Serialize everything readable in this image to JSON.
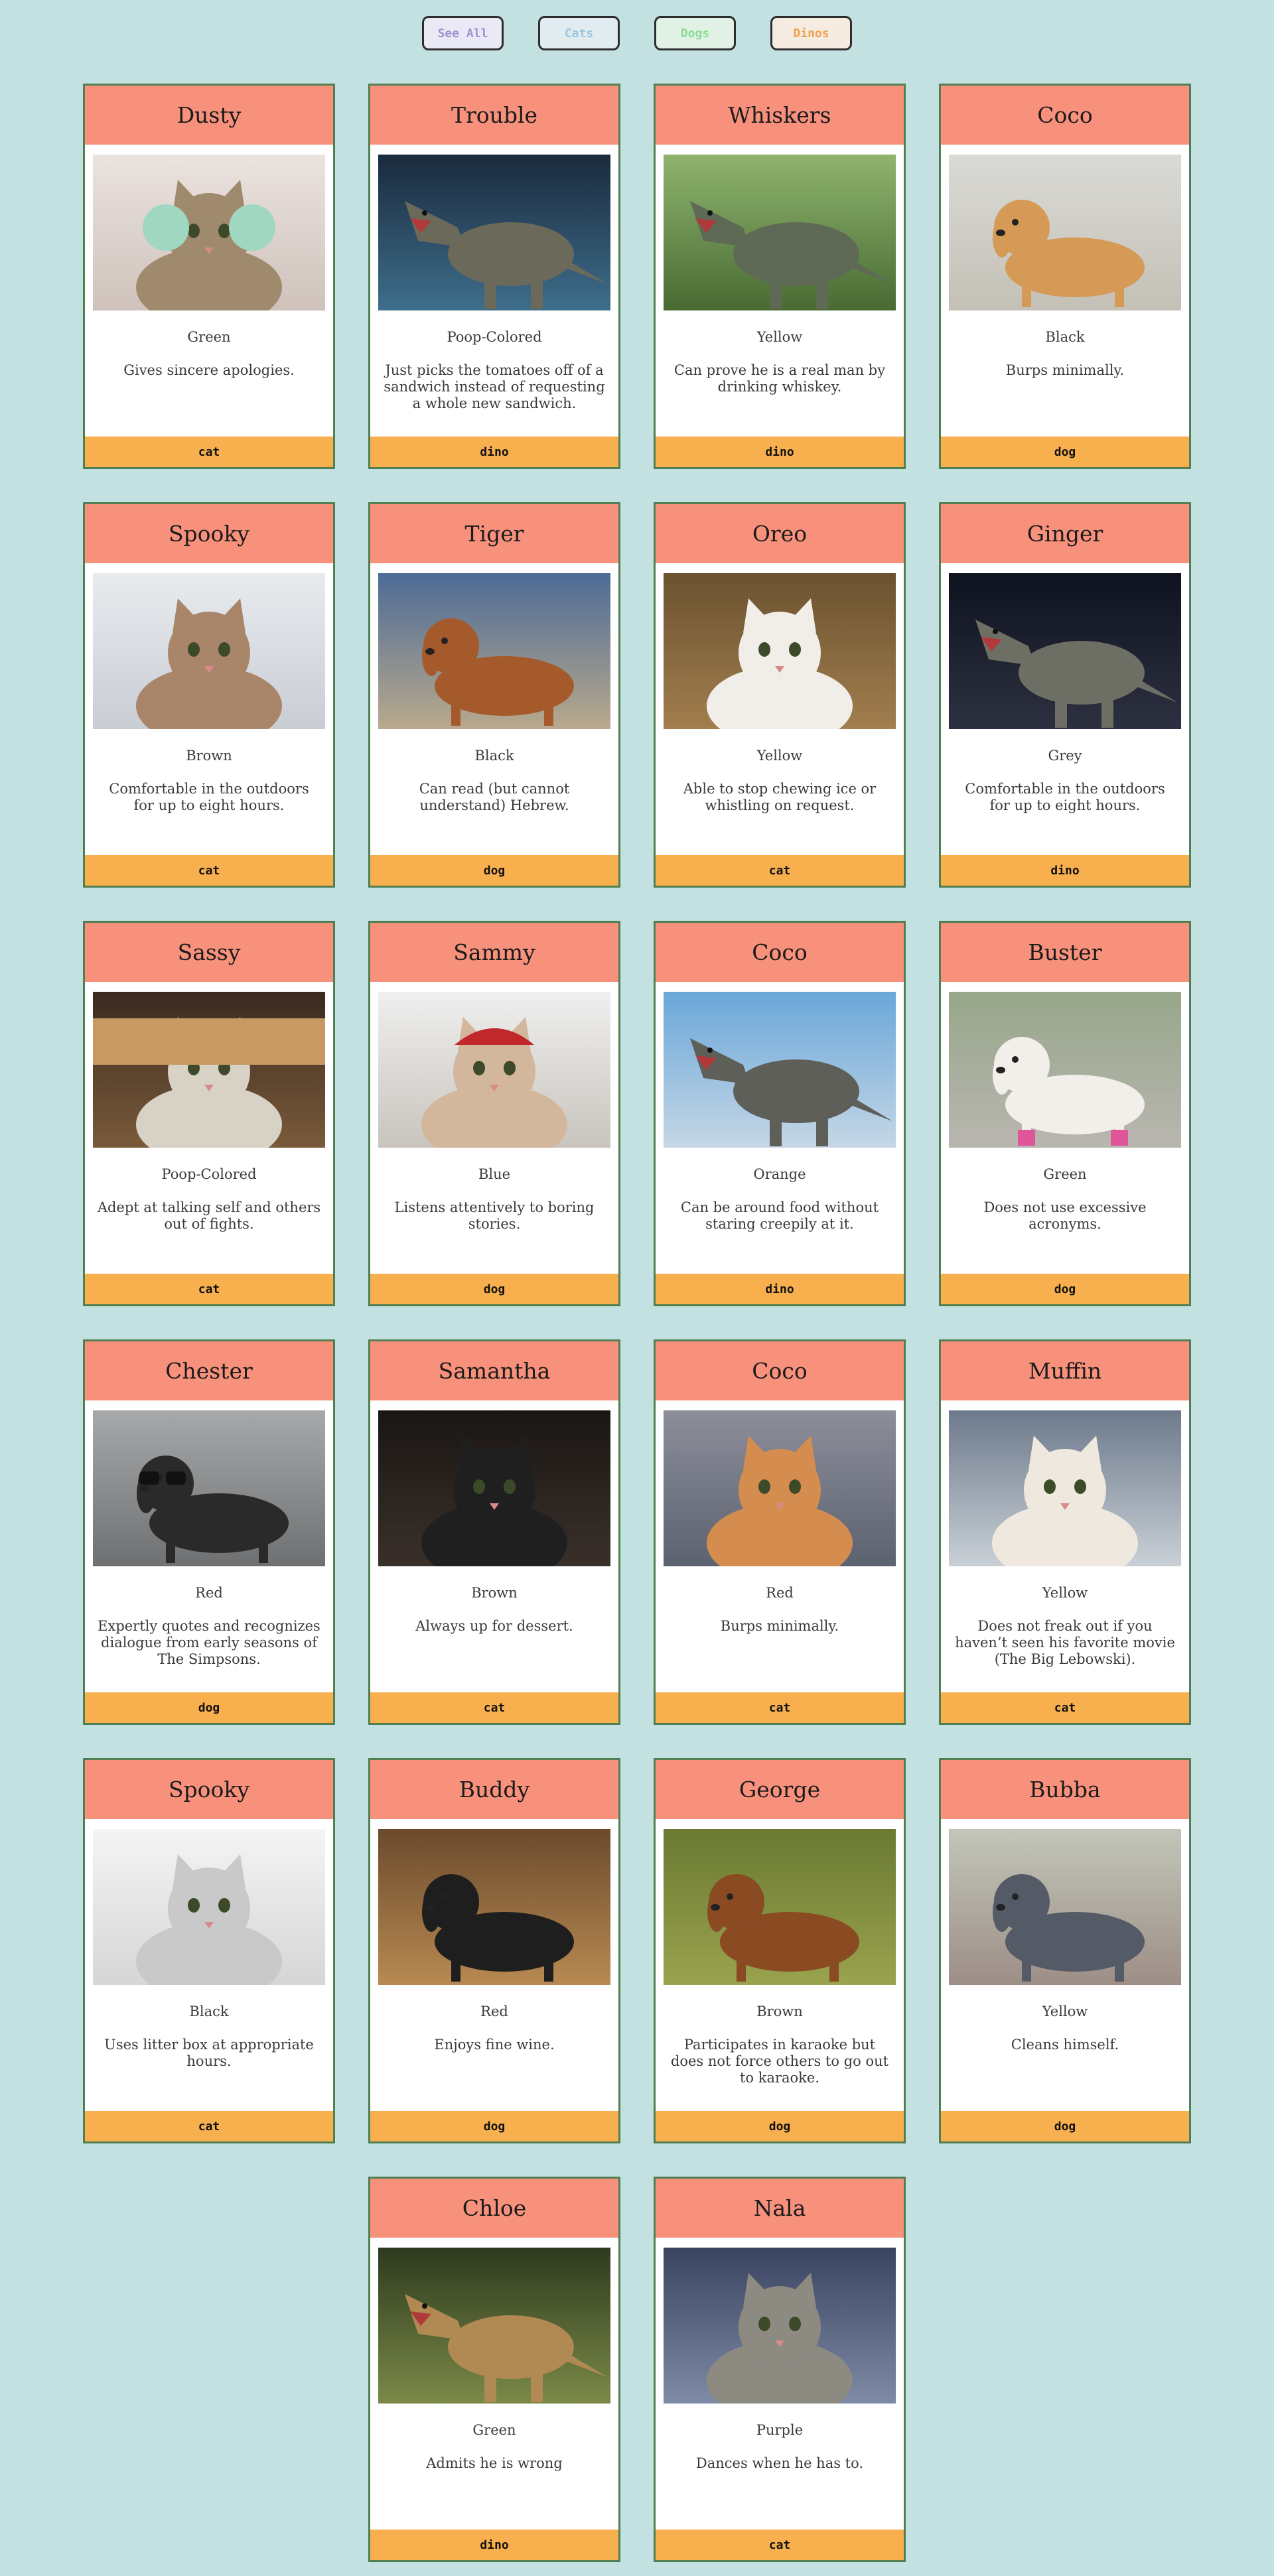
{
  "filters": [
    {
      "label": "See All",
      "cls": "all"
    },
    {
      "label": "Cats",
      "cls": "cats"
    },
    {
      "label": "Dogs",
      "cls": "dogs"
    },
    {
      "label": "Dinos",
      "cls": "dinos"
    }
  ],
  "pets": [
    {
      "name": "Dusty",
      "color": "Green",
      "desc": "Gives sincere apologies.",
      "type": "cat",
      "photo": "cat-with-yarn-earmuffs"
    },
    {
      "name": "Trouble",
      "color": "Poop-Colored",
      "desc": "Just picks the tomatoes off of a sandwich instead of requesting a whole new sandwich.",
      "type": "dino",
      "photo": "dinosaur-spinosaurus"
    },
    {
      "name": "Whiskers",
      "color": "Yellow",
      "desc": "Can prove he is a real man by drinking whiskey.",
      "type": "dino",
      "photo": "dinosaur-trex-forest"
    },
    {
      "name": "Coco",
      "color": "Black",
      "desc": "Burps minimally.",
      "type": "dog",
      "photo": "corgi-with-stick"
    },
    {
      "name": "Spooky",
      "color": "Brown",
      "desc": "Comfortable in the outdoors for up to eight hours.",
      "type": "cat",
      "photo": "maine-coon-cat"
    },
    {
      "name": "Tiger",
      "color": "Black",
      "desc": "Can read (but cannot understand) Hebrew.",
      "type": "dog",
      "photo": "basset-hound-running"
    },
    {
      "name": "Oreo",
      "color": "Yellow",
      "desc": "Able to stop chewing ice or whistling on request.",
      "type": "cat",
      "photo": "sleeping-cat"
    },
    {
      "name": "Ginger",
      "color": "Grey",
      "desc": "Comfortable in the outdoors for up to eight hours.",
      "type": "dino",
      "photo": "dinosaur-with-hat"
    },
    {
      "name": "Sassy",
      "color": "Poop-Colored",
      "desc": "Adept at talking self and others out of fights.",
      "type": "cat",
      "photo": "cat-in-paper-bag"
    },
    {
      "name": "Sammy",
      "color": "Blue",
      "desc": "Listens attentively to boring stories.",
      "type": "dog",
      "photo": "grumpy-cat-devil-hat"
    },
    {
      "name": "Coco",
      "color": "Orange",
      "desc": "Can be around food without staring creepily at it.",
      "type": "dino",
      "photo": "dinosaur-spinosaurus-outdoor"
    },
    {
      "name": "Buster",
      "color": "Green",
      "desc": "Does not use excessive acronyms.",
      "type": "dog",
      "photo": "jack-russell-pink-boots"
    },
    {
      "name": "Chester",
      "color": "Red",
      "desc": "Expertly quotes and recognizes dialogue from early seasons of The Simpsons.",
      "type": "dog",
      "photo": "dog-with-glasses"
    },
    {
      "name": "Samantha",
      "color": "Brown",
      "desc": "Always up for dessert.",
      "type": "cat",
      "photo": "black-white-cat"
    },
    {
      "name": "Coco",
      "color": "Red",
      "desc": "Burps minimally.",
      "type": "cat",
      "photo": "orange-cat-waving"
    },
    {
      "name": "Muffin",
      "color": "Yellow",
      "desc": "Does not freak out if you haven’t seen his favorite movie (The Big Lebowski).",
      "type": "cat",
      "photo": "cat-yawning"
    },
    {
      "name": "Spooky",
      "color": "Black",
      "desc": "Uses litter box at appropriate hours.",
      "type": "cat",
      "photo": "white-persian-cat"
    },
    {
      "name": "Buddy",
      "color": "Red",
      "desc": "Enjoys fine wine.",
      "type": "dog",
      "photo": "wet-black-white-dog"
    },
    {
      "name": "George",
      "color": "Brown",
      "desc": "Participates in karaoke but does not force others to go out to karaoke.",
      "type": "dog",
      "photo": "basset-hound-lying"
    },
    {
      "name": "Bubba",
      "color": "Yellow",
      "desc": "Cleans himself.",
      "type": "dog",
      "photo": "grey-whippet"
    },
    {
      "name": "Chloe",
      "color": "Green",
      "desc": "Admits he is wrong",
      "type": "dino",
      "photo": "dinosaur-trex-roaring"
    },
    {
      "name": "Nala",
      "color": "Purple",
      "desc": "Dances when he has to.",
      "type": "cat",
      "photo": "startled-tabby-cat"
    }
  ]
}
